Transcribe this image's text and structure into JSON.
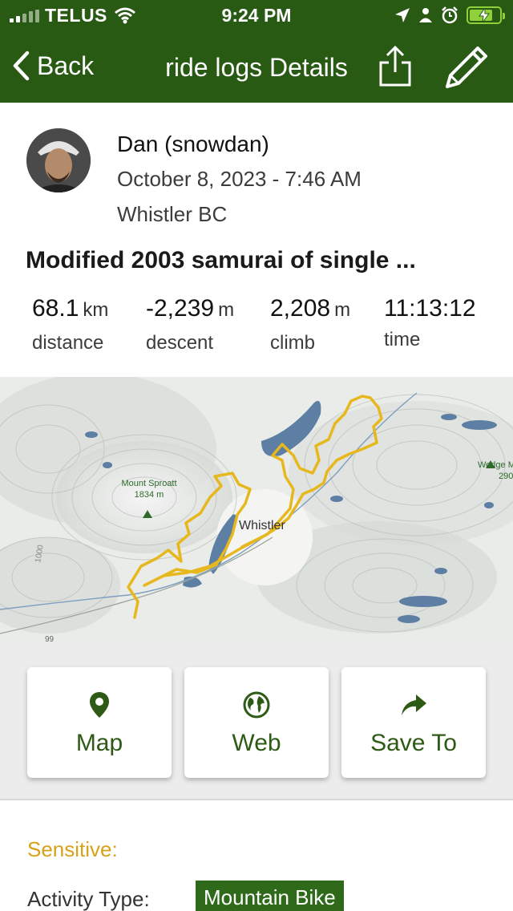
{
  "status_bar": {
    "carrier": "TELUS",
    "time": "9:24 PM",
    "icons": [
      "signal-icon",
      "wifi-icon",
      "location-arrow-icon",
      "person-icon",
      "alarm-icon",
      "battery-charging-icon"
    ]
  },
  "nav": {
    "back_label": "Back",
    "title": "ride logs Details",
    "icons": [
      "share-icon",
      "edit-pencil-icon"
    ]
  },
  "profile": {
    "name": "Dan (snowdan)",
    "date": "October 8, 2023 - 7:46 AM",
    "location": "Whistler BC"
  },
  "ride": {
    "title": "Modified 2003 samurai of single ..."
  },
  "stats": [
    {
      "value": "68.1",
      "unit": "km",
      "label": "distance"
    },
    {
      "value": "-2,239",
      "unit": "m",
      "label": "descent"
    },
    {
      "value": "2,208",
      "unit": "m",
      "label": "climb"
    },
    {
      "value": "11:13:12",
      "unit": "",
      "label": "time"
    }
  ],
  "map": {
    "town_label": "Whistler",
    "peak_name": "Mount Sproatt",
    "peak_elev": "1834 m",
    "edge_label_1": "Wedge M",
    "edge_label_2": "290",
    "contour_label": "1000",
    "road_label": "99",
    "route_color": "#e6b81e",
    "water_color": "#5d7fa3"
  },
  "actions": [
    {
      "label": "Map",
      "icon": "map-pin-icon"
    },
    {
      "label": "Web",
      "icon": "globe-icon"
    },
    {
      "label": "Save To",
      "icon": "share-arrow-icon"
    }
  ],
  "details": {
    "sensitive_label": "Sensitive:",
    "activity_label": "Activity Type:",
    "activity_value": "Mountain Bike"
  },
  "colors": {
    "header": "#285a13",
    "accent_green": "#2d5a14",
    "sensitive": "#d6a21c"
  }
}
